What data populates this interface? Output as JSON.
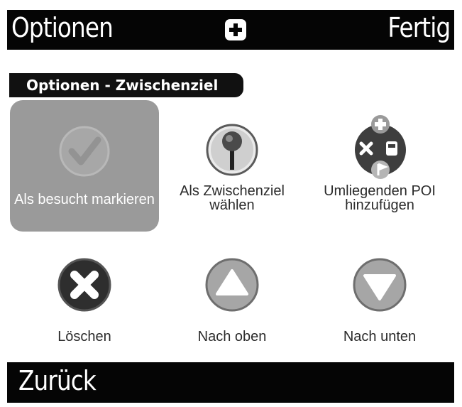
{
  "topbar": {
    "title": "Optionen",
    "add_icon": "plus-icon",
    "done_label": "Fertig"
  },
  "section": {
    "label": "Optionen - Zwischenziel"
  },
  "options": [
    {
      "label": "Als besucht markieren",
      "icon": "checkmark-icon",
      "selected": true
    },
    {
      "label": "Als Zwischenziel wählen",
      "icon": "map-pin-icon",
      "selected": false
    },
    {
      "label": "Umliegenden POI hinzufügen",
      "icon": "poi-cluster-icon",
      "selected": false
    },
    {
      "label": "Löschen",
      "icon": "delete-x-icon",
      "selected": false
    },
    {
      "label": "Nach oben",
      "icon": "arrow-up-icon",
      "selected": false
    },
    {
      "label": "Nach unten",
      "icon": "arrow-down-icon",
      "selected": false
    }
  ],
  "bottombar": {
    "back_label": "Zurück"
  }
}
